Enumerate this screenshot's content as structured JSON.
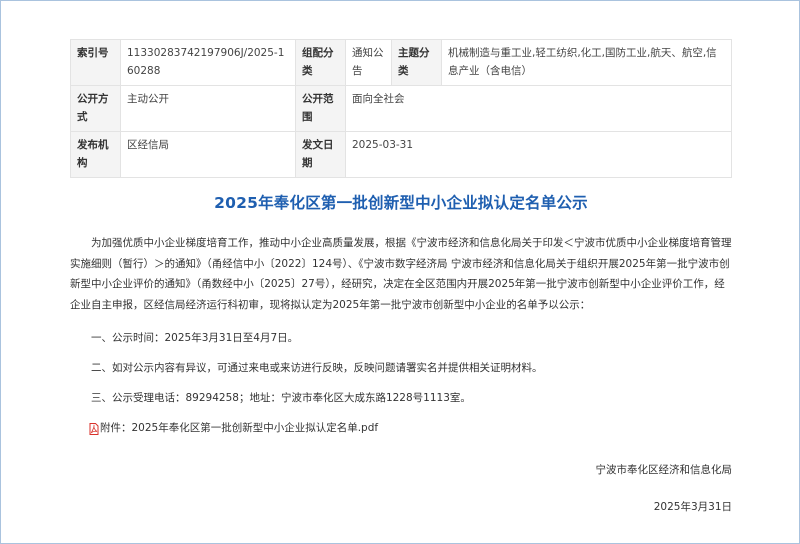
{
  "meta": {
    "index_no_label": "索引号",
    "index_no": "11330283742197906J/2025-160288",
    "category_label": "组配分类",
    "category": "通知公告",
    "topic_label": "主题分类",
    "topic": "机械制造与重工业,轻工纺织,化工,国防工业,航天、航空,信息产业（含电信）",
    "open_mode_label": "公开方式",
    "open_mode": "主动公开",
    "open_scope_label": "公开范围",
    "open_scope": "面向全社会",
    "publisher_label": "发布机构",
    "publisher": "区经信局",
    "date_label": "发文日期",
    "date": "2025-03-31"
  },
  "title": "2025年奉化区第一批创新型中小企业拟认定名单公示",
  "intro": "为加强优质中小企业梯度培育工作，推动中小企业高质量发展，根据《宁波市经济和信息化局关于印发＜宁波市优质中小企业梯度培育管理实施细则（暂行）＞的通知》（甬经信中小〔2022〕124号）、《宁波市数字经济局 宁波市经济和信息化局关于组织开展2025年第一批宁波市创新型中小企业评价的通知》（甬数经中小〔2025〕27号），经研究，决定在全区范围内开展2025年第一批宁波市创新型中小企业评价工作，经企业自主申报，区经信局经济运行科初审，现将拟认定为2025年第一批宁波市创新型中小企业的名单予以公示：",
  "items": [
    "一、公示时间：2025年3月31日至4月7日。",
    "二、如对公示内容有异议，可通过来电或来访进行反映，反映问题请署实名并提供相关证明材料。",
    "三、公示受理电话：89294258；地址：宁波市奉化区大成东路1228号1113室。"
  ],
  "attachment": {
    "icon": "pdf-icon",
    "label": "附件：2025年奉化区第一批创新型中小企业拟认定名单.pdf"
  },
  "signature": {
    "org": "宁波市奉化区经济和信息化局",
    "date": "2025年3月31日"
  },
  "colors": {
    "title": "#1f5fb0",
    "label_bg": "#f4f4f4",
    "border": "#e3e3e3",
    "frame": "#aac3de",
    "pdf_icon": "#d9322b"
  }
}
